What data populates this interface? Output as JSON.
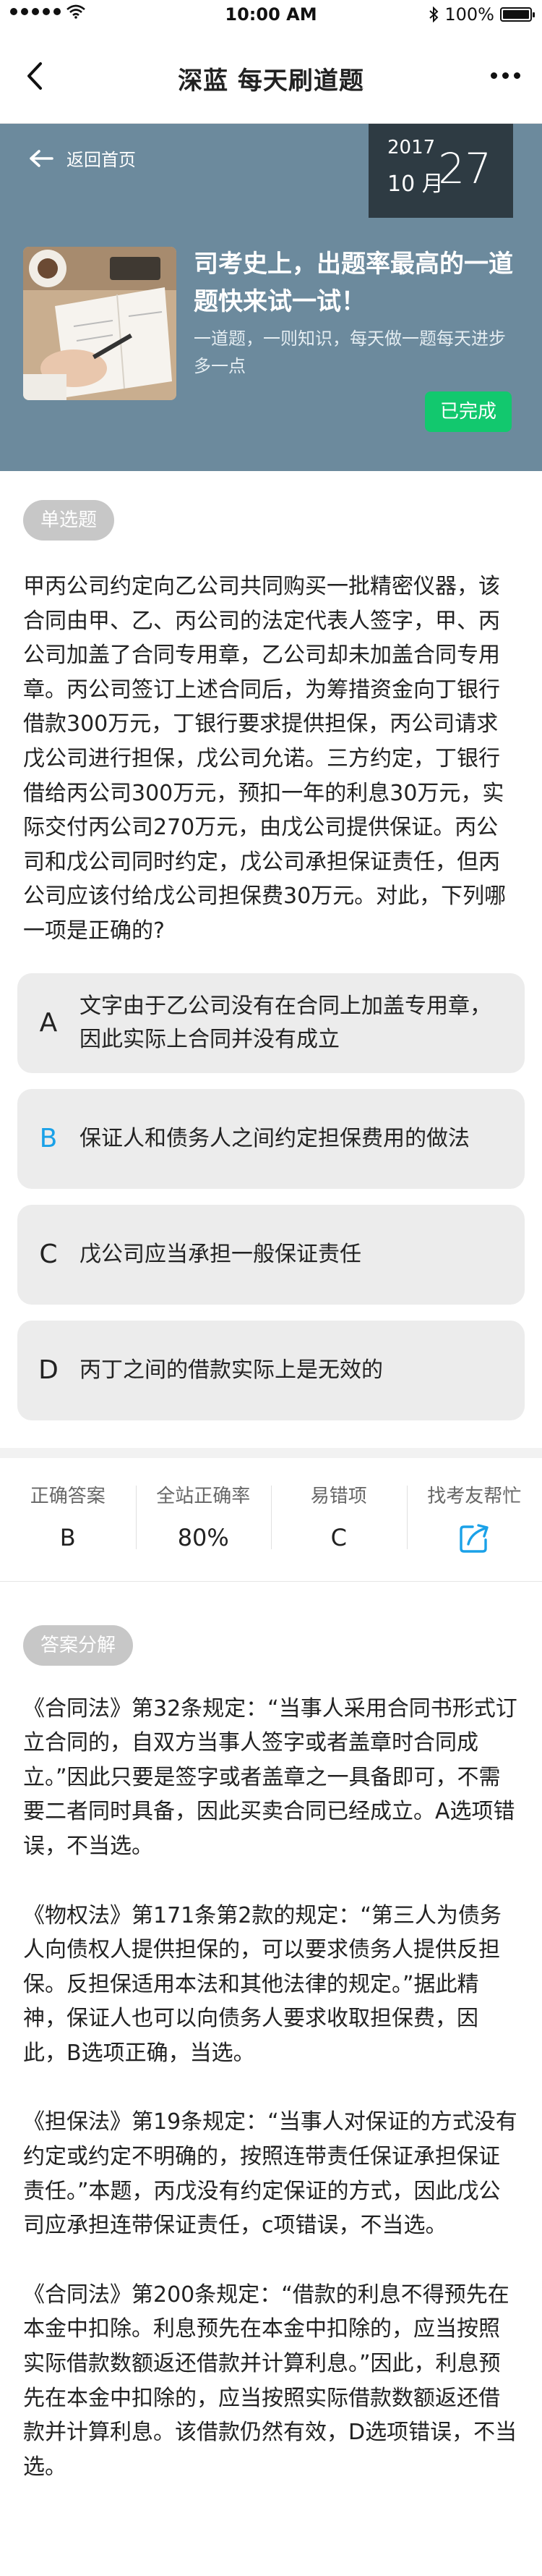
{
  "status_bar": {
    "time": "10:00 AM",
    "battery": "100%",
    "battery_level": 1.0
  },
  "nav": {
    "title": "深蓝   每天刷道题"
  },
  "hero": {
    "home_link": "返回首页",
    "date": {
      "year": "2017",
      "month": "10 月",
      "day": "27"
    },
    "headline": "司考史上，出题率最高的一道题快来试一试！",
    "subtitle": "一道题，一则知识，每天做一题每天进步多一点",
    "status_badge": "已完成",
    "colors": {
      "banner": "#6c8a9d",
      "date_box": "#2e3b43",
      "badge": "#12c86e"
    }
  },
  "question": {
    "type": "单选题",
    "text": "甲丙公司约定向乙公司共同购买一批精密仪器，该合同由甲、乙、丙公司的法定代表人签字，甲、丙公司加盖了合同专用章，乙公司却未加盖合同专用章。丙公司签订上述合同后，为筹措资金向丁银行借款300万元，丁银行要求提供担保，丙公司请求戊公司进行担保，戊公司允诺。三方约定，丁银行借给丙公司300万元，预扣一年的利息30万元，实际交付丙公司270万元，由戊公司提供保证。丙公司和戊公司同时约定，戊公司承担保证责任，但丙公司应该付给戊公司担保费30万元。对此，下列哪一项是正确的?"
  },
  "options": [
    {
      "letter": "A",
      "text": "文字由于乙公司没有在合同上加盖专用章，因此实际上合同并没有成立",
      "highlighted": false
    },
    {
      "letter": "B",
      "text": "保证人和债务人之间约定担保费用的做法",
      "highlighted": true
    },
    {
      "letter": "C",
      "text": "戊公司应当承担一般保证责任",
      "highlighted": false
    },
    {
      "letter": "D",
      "text": "丙丁之间的借款实际上是无效的",
      "highlighted": false
    }
  ],
  "stats": {
    "correct_answer": {
      "label": "正确答案",
      "value": "B"
    },
    "site_accuracy": {
      "label": "全站正确率",
      "value": "80%"
    },
    "common_mistake": {
      "label": "易错项",
      "value": "C"
    },
    "ask_friends": {
      "label": "找考友帮忙",
      "icon": "share-icon"
    }
  },
  "analysis": {
    "title": "答案分解",
    "paragraphs": [
      "《合同法》第32条规定：“当事人采用合同书形式订立合同的，自双方当事人签字或者盖章时合同成立。”因此只要是签字或者盖章之一具备即可，不需要二者同时具备，因此买卖合同已经成立。A选项错误，不当选。",
      "《物权法》第171条第2款的规定：“第三人为债务人向债权人提供担保的，可以要求债务人提供反担保。反担保适用本法和其他法律的规定。”据此精神，保证人也可以向债务人要求收取担保费，因此，B选项正确，当选。",
      "《担保法》第19条规定：“当事人对保证的方式没有约定或约定不明确的，按照连带责任保证承担保证责任。”本题，丙戊没有约定保证的方式，因此戊公司应承担连带保证责任，c项错误，不当选。",
      "《合同法》第200条规定：“借款的利息不得预先在本金中扣除。利息预先在本金中扣除的，应当按照实际借款数额返还借款并计算利息。”因此，利息预先在本金中扣除的，应当按照实际借款数额返还借款并计算利息。该借款仍然有效，D选项错误，不当选。"
    ]
  }
}
